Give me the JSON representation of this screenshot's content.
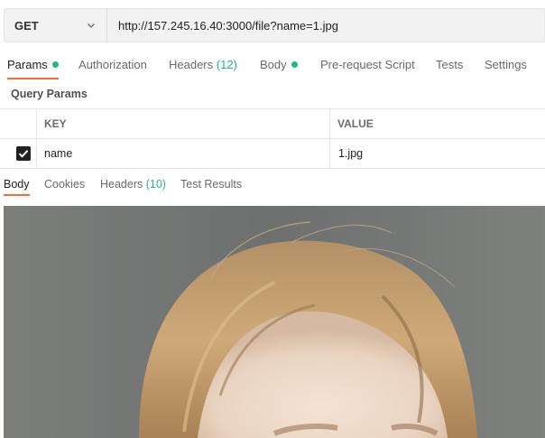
{
  "request": {
    "method": "GET",
    "url": "http://157.245.16.40:3000/file?name=1.jpg"
  },
  "tabs": [
    {
      "label": "Params",
      "dot": true
    },
    {
      "label": "Authorization"
    },
    {
      "label": "Headers",
      "count": "(12)"
    },
    {
      "label": "Body",
      "dot": true
    },
    {
      "label": "Pre-request Script"
    },
    {
      "label": "Tests"
    },
    {
      "label": "Settings"
    }
  ],
  "query_params": {
    "section_label": "Query Params",
    "columns": [
      "KEY",
      "VALUE"
    ],
    "rows": [
      {
        "checked": true,
        "key": "name",
        "value": "1.jpg"
      }
    ]
  },
  "response_tabs": [
    {
      "label": "Body"
    },
    {
      "label": "Cookies"
    },
    {
      "label": "Headers",
      "count": "(10)"
    },
    {
      "label": "Test Results"
    }
  ],
  "colors": {
    "accent": "#f26b3a",
    "success": "#26b47f",
    "image_background": "#737573",
    "hair": "#c9a473",
    "skin": "#eedbca"
  },
  "icons": {
    "method_dropdown": "chevron-down-icon",
    "checkbox": "check-icon"
  }
}
